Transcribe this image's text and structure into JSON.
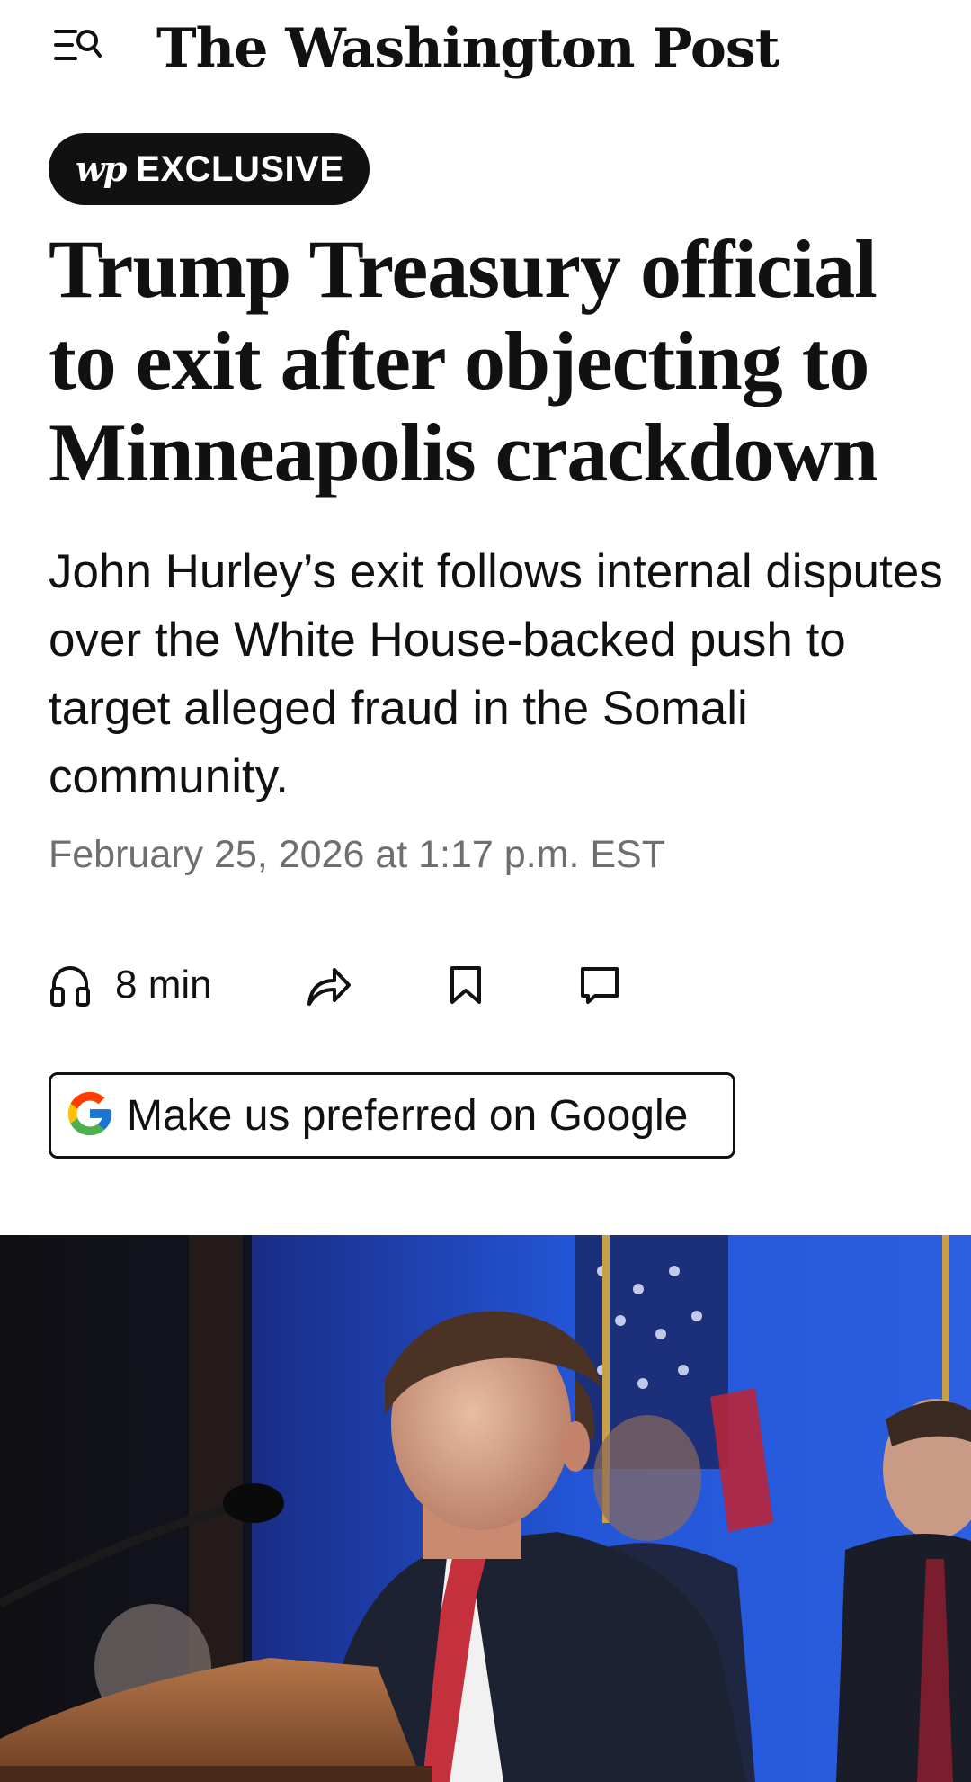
{
  "header": {
    "masthead": "The Washington Post",
    "menu_search_icon": "menu-search-icon"
  },
  "badge": {
    "logo": "wp",
    "label": "EXCLUSIVE"
  },
  "article": {
    "headline": "Trump Treasury official to exit after objecting to Minneapolis crackdown",
    "dek": "John Hurley’s exit follows internal disputes over the White House-backed push to target alleged fraud in the Somali community.",
    "timestamp": "February 25, 2026 at 1:17 p.m. EST"
  },
  "actions": {
    "listen_label": "8 min",
    "listen_icon": "headphones-icon",
    "share_icon": "share-icon",
    "save_icon": "bookmark-icon",
    "comment_icon": "comment-icon"
  },
  "google_button": {
    "label": "Make us preferred on Google",
    "icon": "google-g-icon"
  },
  "colors": {
    "text": "#111111",
    "timestamp": "#6f6f6f",
    "badge_bg": "#111111",
    "photo_backdrop": "#1f4fd6"
  }
}
